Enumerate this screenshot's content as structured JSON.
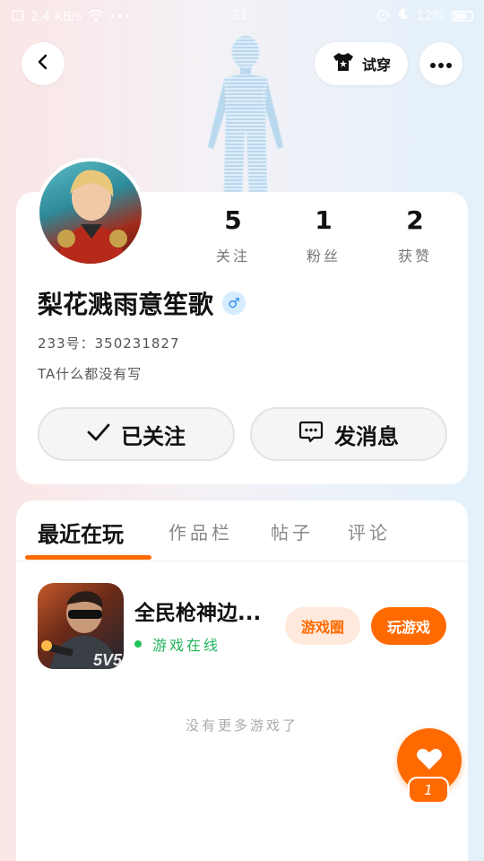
{
  "status_bar": {
    "left_info": "2.4 KB/s",
    "time": "21:",
    "battery": "12%"
  },
  "header": {
    "try_on_label": "试穿"
  },
  "profile": {
    "stats": [
      {
        "value": "5",
        "label": "关注"
      },
      {
        "value": "1",
        "label": "粉丝"
      },
      {
        "value": "2",
        "label": "获赞"
      }
    ],
    "nickname": "梨花溅雨意笙歌",
    "gender_symbol": "♂",
    "uid": "233号：350231827",
    "bio": "TA什么都没有写",
    "follow_label": "已关注",
    "message_label": "发消息"
  },
  "tabs": [
    {
      "label": "最近在玩",
      "active": true
    },
    {
      "label": "作品栏",
      "active": false
    },
    {
      "label": "帖子",
      "active": false
    },
    {
      "label": "评论",
      "active": false
    }
  ],
  "game": {
    "title": "全民枪神边...",
    "status": "游戏在线",
    "icon_text": "5V5",
    "circle_label": "游戏圈",
    "play_label": "玩游戏"
  },
  "empty_hint": "没有更多游戏了",
  "like": {
    "count": "1"
  },
  "colors": {
    "accent": "#ff6a00",
    "accent_light": "#ffe9dc",
    "online": "#21c45b",
    "gender_blue": "#2d8cf0"
  }
}
